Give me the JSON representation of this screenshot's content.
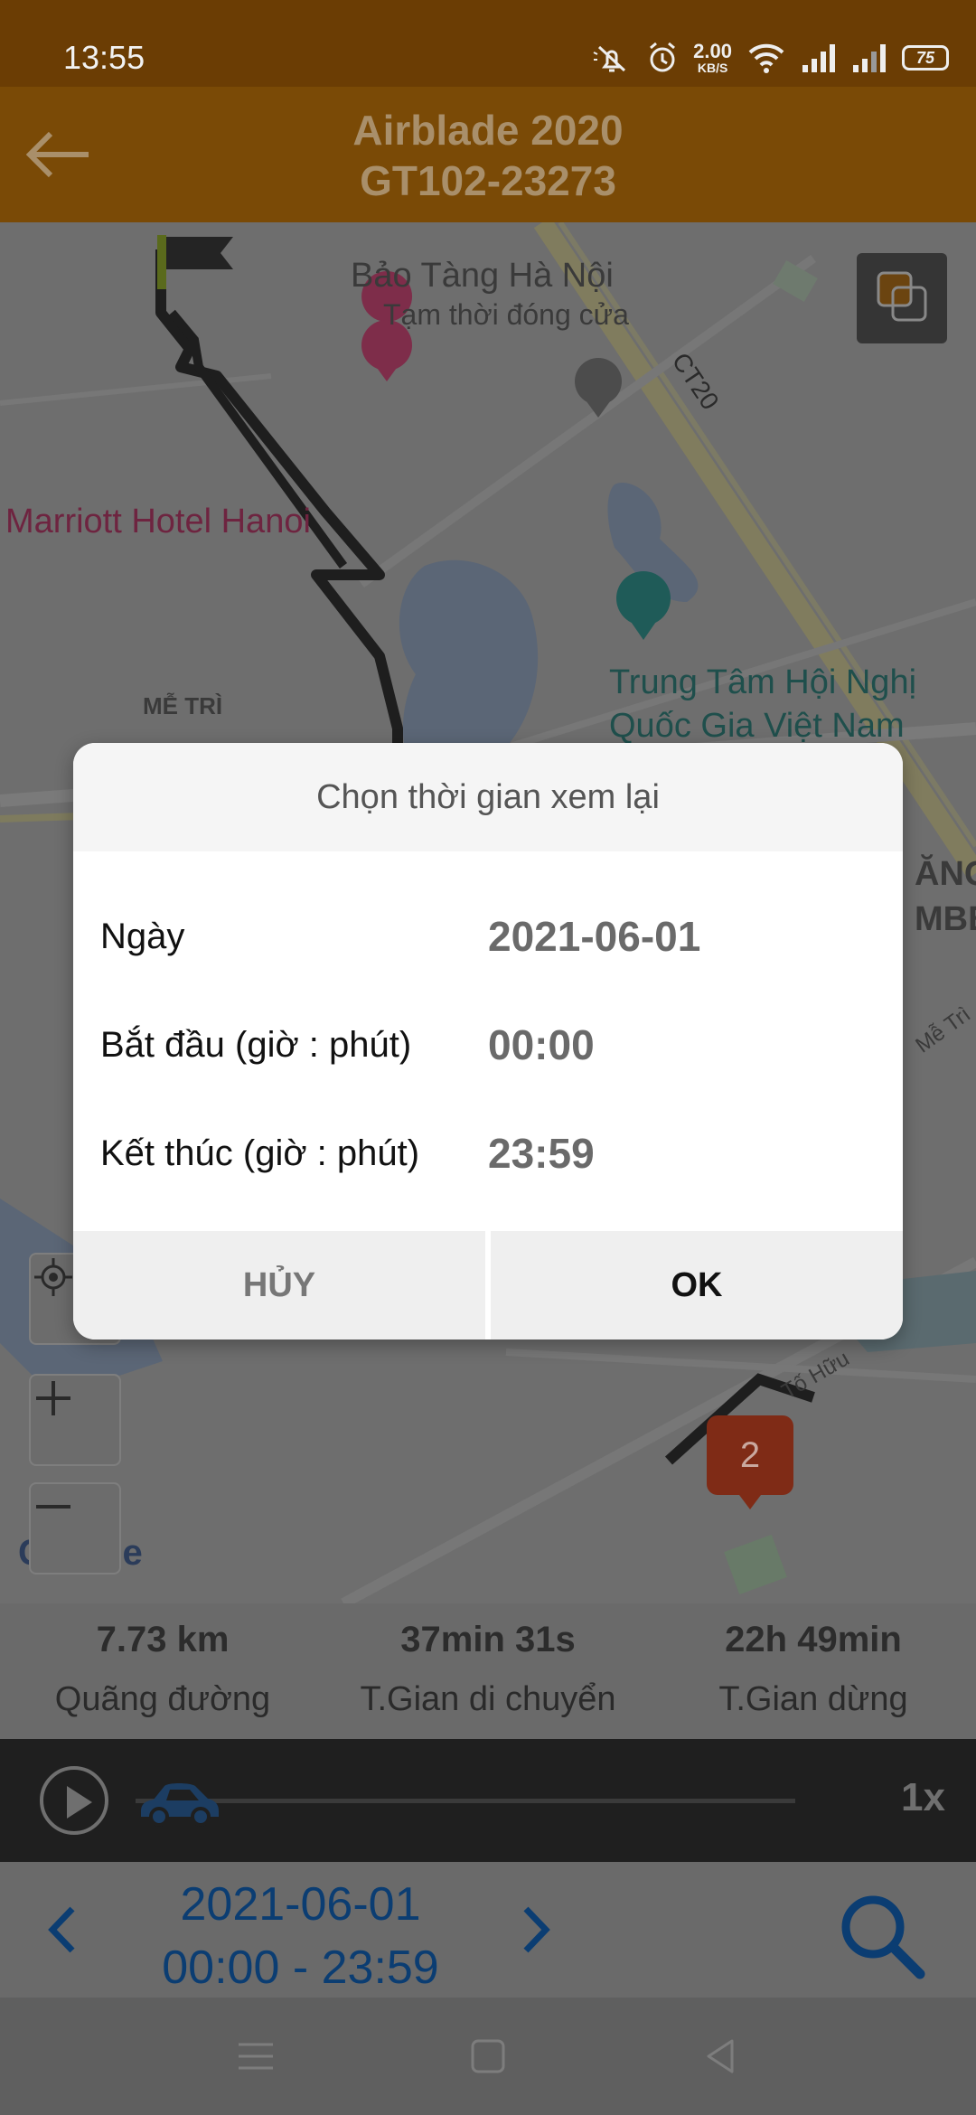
{
  "status_bar": {
    "time": "13:55",
    "net_speed_value": "2.00",
    "net_speed_unit": "KB/S",
    "battery": "75",
    "icons": [
      "mute-icon",
      "alarm-icon",
      "wifi-icon",
      "signal-icon",
      "signal-icon",
      "battery-icon"
    ]
  },
  "header": {
    "title_line1": "Airblade 2020",
    "title_line2": "GT102-23273",
    "back_icon": "arrow-left-icon"
  },
  "map": {
    "labels": {
      "museum": "Bảo Tàng Hà Nội",
      "museum_status": "Tạm thời đóng cửa",
      "road_ct20": "CT20",
      "hotel": "Marriott Hotel Hanoi",
      "district": "MỄ TRÌ",
      "convention_line1": "Trung Tâm Hội Nghị",
      "convention_line2": "Quốc Gia Việt Nam",
      "edge_1": "ĂNG",
      "edge_2": "MBE",
      "edge_street": "Mễ Trì",
      "street_tohuu": "Tố Hữu",
      "google": "Google"
    },
    "cluster_count": "2"
  },
  "stats": [
    {
      "value": "7.73 km",
      "label": "Quãng đường"
    },
    {
      "value": "37min 31s",
      "label": "T.Gian di chuyển"
    },
    {
      "value": "22h 49min",
      "label": "T.Gian dừng"
    }
  ],
  "playback": {
    "speed": "1x",
    "progress": 0
  },
  "date_nav": {
    "date": "2021-06-01",
    "range": "00:00 - 23:59"
  },
  "dialog": {
    "title": "Chọn thời gian xem lại",
    "rows": [
      {
        "label": "Ngày",
        "value": "2021-06-01"
      },
      {
        "label": "Bắt đầu (giờ : phút)",
        "value": "00:00"
      },
      {
        "label": "Kết thúc (giờ : phút)",
        "value": "23:59"
      }
    ],
    "cancel": "HỦY",
    "ok": "OK"
  },
  "colors": {
    "header_dim": "#7a4a06",
    "status_dim": "#6b3d04",
    "date_blue": "#0b3d72",
    "cluster_red": "#7f2b16"
  }
}
